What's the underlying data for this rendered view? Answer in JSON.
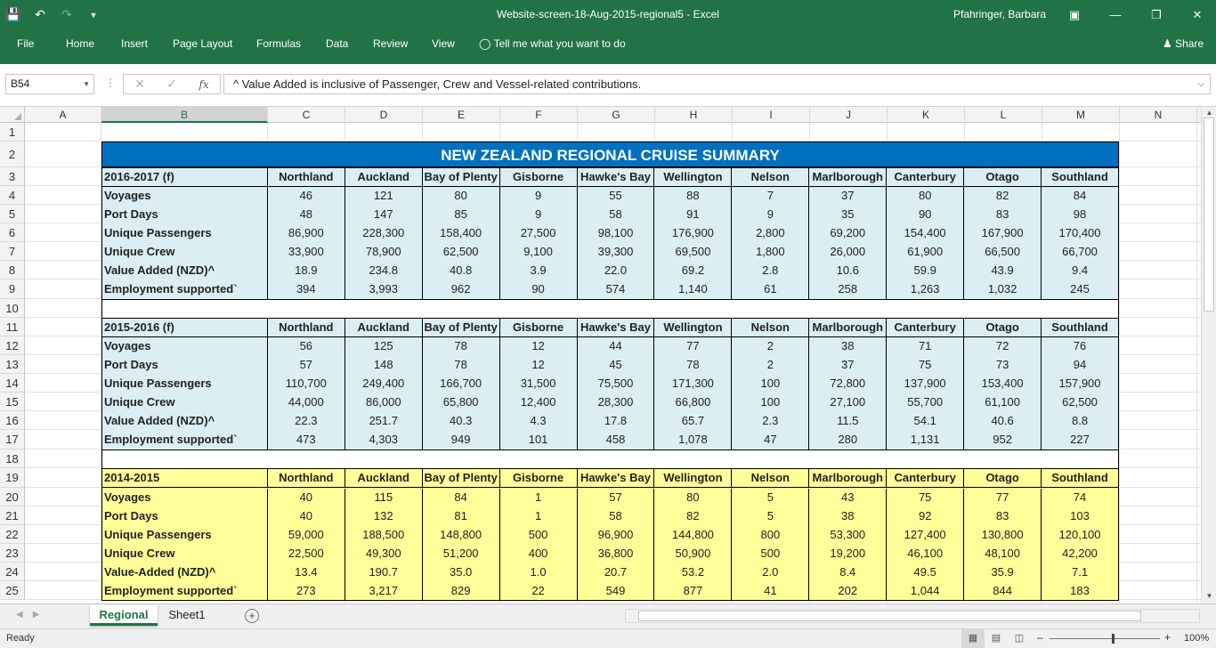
{
  "app": {
    "doc_title": "Website-screen-18-Aug-2015-regional5 - Excel",
    "user": "Pfahringer, Barbara",
    "share": "Share"
  },
  "ribbon": {
    "tabs": [
      "File",
      "Home",
      "Insert",
      "Page Layout",
      "Formulas",
      "Data",
      "Review",
      "View",
      "Tell me what you want to do"
    ]
  },
  "formula_bar": {
    "name_box": "B54",
    "content": "^ Value Added is inclusive of Passenger, Crew and Vessel-related contributions."
  },
  "columns": [
    "A",
    "B",
    "C",
    "D",
    "E",
    "F",
    "G",
    "H",
    "I",
    "J",
    "K",
    "L",
    "M",
    "N"
  ],
  "rows": [
    "1",
    "2",
    "3",
    "4",
    "5",
    "6",
    "7",
    "8",
    "9",
    "10",
    "11",
    "12",
    "13",
    "14",
    "15",
    "16",
    "17",
    "18",
    "19",
    "20",
    "21",
    "22",
    "23",
    "24",
    "25"
  ],
  "banner": "NEW ZEALAND REGIONAL CRUISE SUMMARY",
  "blocks": [
    {
      "period": "2016-2017 (f)",
      "regions": [
        "Northland",
        "Auckland",
        "Bay of Plenty",
        "Gisborne",
        "Hawke's Bay",
        "Wellington",
        "Nelson",
        "Marlborough",
        "Canterbury",
        "Otago",
        "Southland"
      ],
      "rows": [
        {
          "label": "Voyages",
          "values": [
            "46",
            "121",
            "80",
            "9",
            "55",
            "88",
            "7",
            "37",
            "80",
            "82",
            "84"
          ]
        },
        {
          "label": "Port Days",
          "values": [
            "48",
            "147",
            "85",
            "9",
            "58",
            "91",
            "9",
            "35",
            "90",
            "83",
            "98"
          ]
        },
        {
          "label": "Unique Passengers",
          "values": [
            "86,900",
            "228,300",
            "158,400",
            "27,500",
            "98,100",
            "176,900",
            "2,800",
            "69,200",
            "154,400",
            "167,900",
            "170,400"
          ]
        },
        {
          "label": "Unique Crew",
          "values": [
            "33,900",
            "78,900",
            "62,500",
            "9,100",
            "39,300",
            "69,500",
            "1,800",
            "26,000",
            "61,900",
            "66,500",
            "66,700"
          ]
        },
        {
          "label": "Value Added (NZD)^",
          "values": [
            "18.9",
            "234.8",
            "40.8",
            "3.9",
            "22.0",
            "69.2",
            "2.8",
            "10.6",
            "59.9",
            "43.9",
            "9.4"
          ]
        },
        {
          "label": "Employment supported`",
          "values": [
            "394",
            "3,993",
            "962",
            "90",
            "574",
            "1,140",
            "61",
            "258",
            "1,263",
            "1,032",
            "245"
          ]
        }
      ]
    },
    {
      "period": "2015-2016 (f)",
      "regions": [
        "Northland",
        "Auckland",
        "Bay of Plenty",
        "Gisborne",
        "Hawke's Bay",
        "Wellington",
        "Nelson",
        "Marlborough",
        "Canterbury",
        "Otago",
        "Southland"
      ],
      "rows": [
        {
          "label": "Voyages",
          "values": [
            "56",
            "125",
            "78",
            "12",
            "44",
            "77",
            "2",
            "38",
            "71",
            "72",
            "76"
          ]
        },
        {
          "label": "Port Days",
          "values": [
            "57",
            "148",
            "78",
            "12",
            "45",
            "78",
            "2",
            "37",
            "75",
            "73",
            "94"
          ]
        },
        {
          "label": "Unique Passengers",
          "values": [
            "110,700",
            "249,400",
            "166,700",
            "31,500",
            "75,500",
            "171,300",
            "100",
            "72,800",
            "137,900",
            "153,400",
            "157,900"
          ]
        },
        {
          "label": "Unique Crew",
          "values": [
            "44,000",
            "86,000",
            "65,800",
            "12,400",
            "28,300",
            "66,800",
            "100",
            "27,100",
            "55,700",
            "61,100",
            "62,500"
          ]
        },
        {
          "label": "Value Added (NZD)^",
          "values": [
            "22.3",
            "251.7",
            "40.3",
            "4.3",
            "17.8",
            "65.7",
            "2.3",
            "11.5",
            "54.1",
            "40.6",
            "8.8"
          ]
        },
        {
          "label": "Employment supported`",
          "values": [
            "473",
            "4,303",
            "949",
            "101",
            "458",
            "1,078",
            "47",
            "280",
            "1,131",
            "952",
            "227"
          ]
        }
      ]
    },
    {
      "period": "2014-2015",
      "regions": [
        "Northland",
        "Auckland",
        "Bay of Plenty",
        "Gisborne",
        "Hawke's Bay",
        "Wellington",
        "Nelson",
        "Marlborough",
        "Canterbury",
        "Otago",
        "Southland"
      ],
      "rows": [
        {
          "label": "Voyages",
          "values": [
            "40",
            "115",
            "84",
            "1",
            "57",
            "80",
            "5",
            "43",
            "75",
            "77",
            "74"
          ]
        },
        {
          "label": "Port Days",
          "values": [
            "40",
            "132",
            "81",
            "1",
            "58",
            "82",
            "5",
            "38",
            "92",
            "83",
            "103"
          ]
        },
        {
          "label": "Unique Passengers",
          "values": [
            "59,000",
            "188,500",
            "148,800",
            "500",
            "96,900",
            "144,800",
            "800",
            "53,300",
            "127,400",
            "130,800",
            "120,100"
          ]
        },
        {
          "label": "Unique Crew",
          "values": [
            "22,500",
            "49,300",
            "51,200",
            "400",
            "36,800",
            "50,900",
            "500",
            "19,200",
            "46,100",
            "48,100",
            "42,200"
          ]
        },
        {
          "label": "Value-Added (NZD)^",
          "values": [
            "13.4",
            "190.7",
            "35.0",
            "1.0",
            "20.7",
            "53.2",
            "2.0",
            "8.4",
            "49.5",
            "35.9",
            "7.1"
          ]
        },
        {
          "label": "Employment supported`",
          "values": [
            "273",
            "3,217",
            "829",
            "22",
            "549",
            "877",
            "41",
            "202",
            "1,044",
            "844",
            "183"
          ]
        }
      ]
    }
  ],
  "sheet_tabs": [
    "Regional",
    "Sheet1"
  ],
  "status": {
    "ready": "Ready",
    "zoom": "100%"
  },
  "colors": {
    "excel_green": "#217346",
    "banner_blue": "#0070c0",
    "block_blue": "#daeef3",
    "block_yellow": "#ffff99"
  }
}
